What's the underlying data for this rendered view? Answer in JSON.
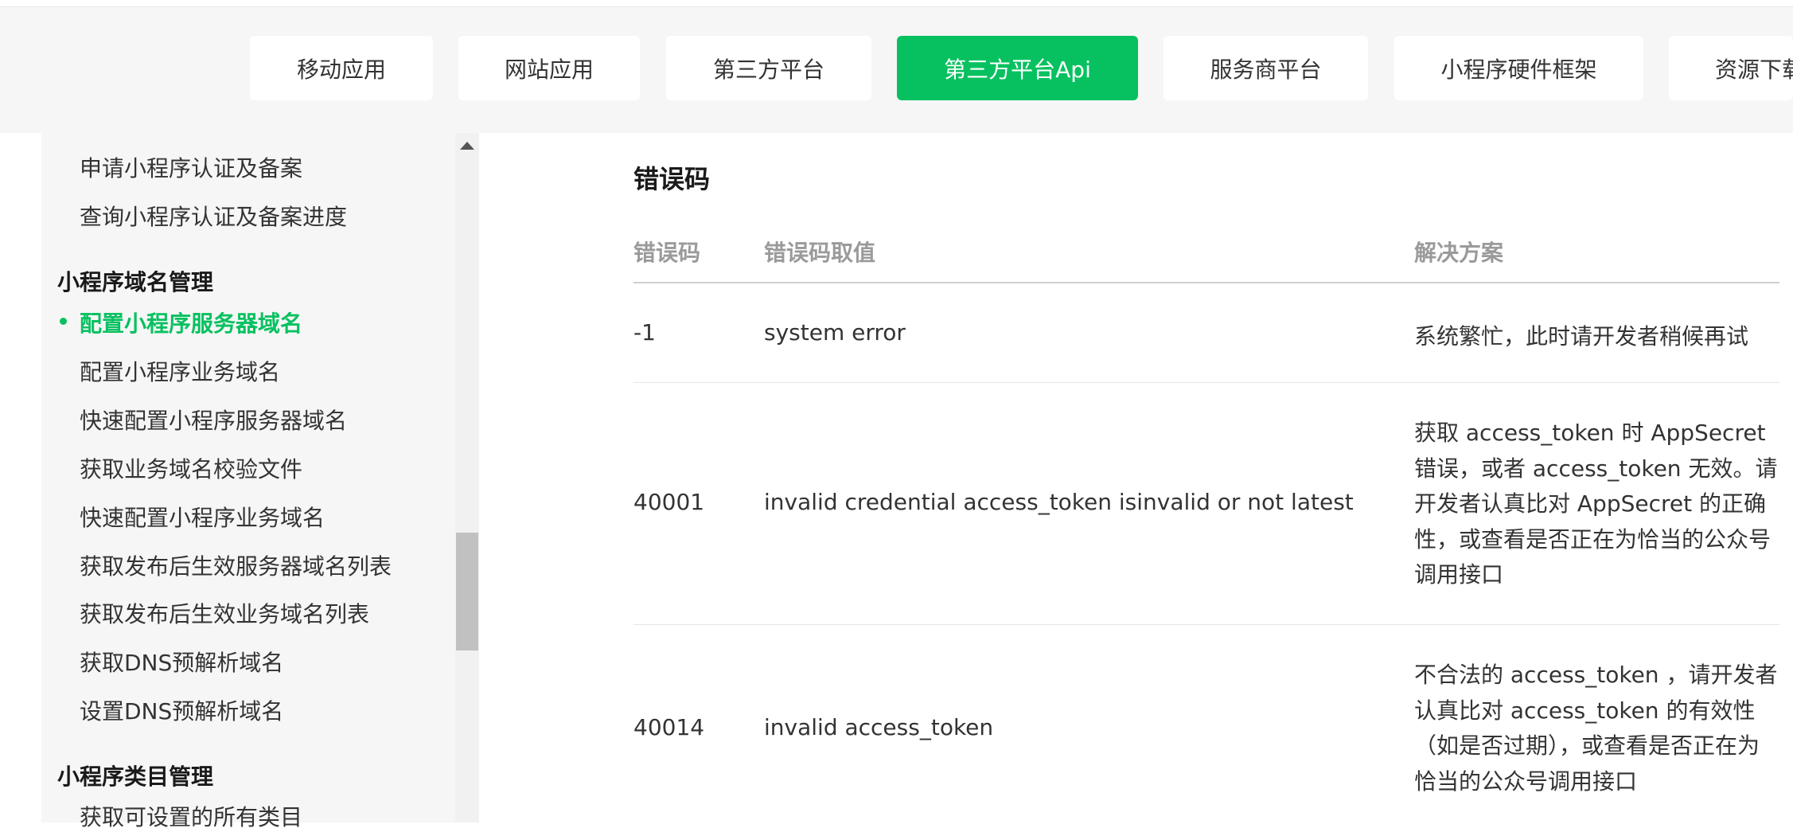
{
  "top_nav": {
    "tabs": [
      {
        "label": "移动应用",
        "active": false
      },
      {
        "label": "网站应用",
        "active": false
      },
      {
        "label": "第三方平台",
        "active": false
      },
      {
        "label": "第三方平台Api",
        "active": true
      },
      {
        "label": "服务商平台",
        "active": false
      },
      {
        "label": "小程序硬件框架",
        "active": false
      },
      {
        "label": "资源下载",
        "active": false
      }
    ]
  },
  "sidebar": {
    "items_top": [
      "申请小程序认证及备案",
      "查询小程序认证及备案进度"
    ],
    "group_domain": "小程序域名管理",
    "active_item": "配置小程序服务器域名",
    "items_domain": [
      "配置小程序业务域名",
      "快速配置小程序服务器域名",
      "获取业务域名校验文件",
      "快速配置小程序业务域名",
      "获取发布后生效服务器域名列表",
      "获取发布后生效业务域名列表",
      "获取DNS预解析域名",
      "设置DNS预解析域名"
    ],
    "group_category": "小程序类目管理",
    "items_category": [
      "获取可设置的所有类目"
    ]
  },
  "content": {
    "section_title": "错误码",
    "table": {
      "headers": [
        "错误码",
        "错误码取值",
        "解决方案"
      ],
      "rows": [
        {
          "code": "-1",
          "value": "system error",
          "solution": "系统繁忙，此时请开发者稍候再试"
        },
        {
          "code": "40001",
          "value": "invalid credential  access_token isinvalid or not latest",
          "solution": "获取 access_token 时 AppSecret 错误，或者 access_token 无效。请开发者认真比对 AppSecret 的正确性，或查看是否正在为恰当的公众号调用接口"
        },
        {
          "code": "40014",
          "value": "invalid access_token",
          "solution": "不合法的 access_token ，请开发者认真比对 access_token 的有效性（如是否过期），或查看是否正在为恰当的公众号调用接口"
        }
      ]
    }
  },
  "colors": {
    "accent": "#07c160",
    "nav_bg": "#f6f6f6",
    "header_text": "#9a9a9a"
  }
}
